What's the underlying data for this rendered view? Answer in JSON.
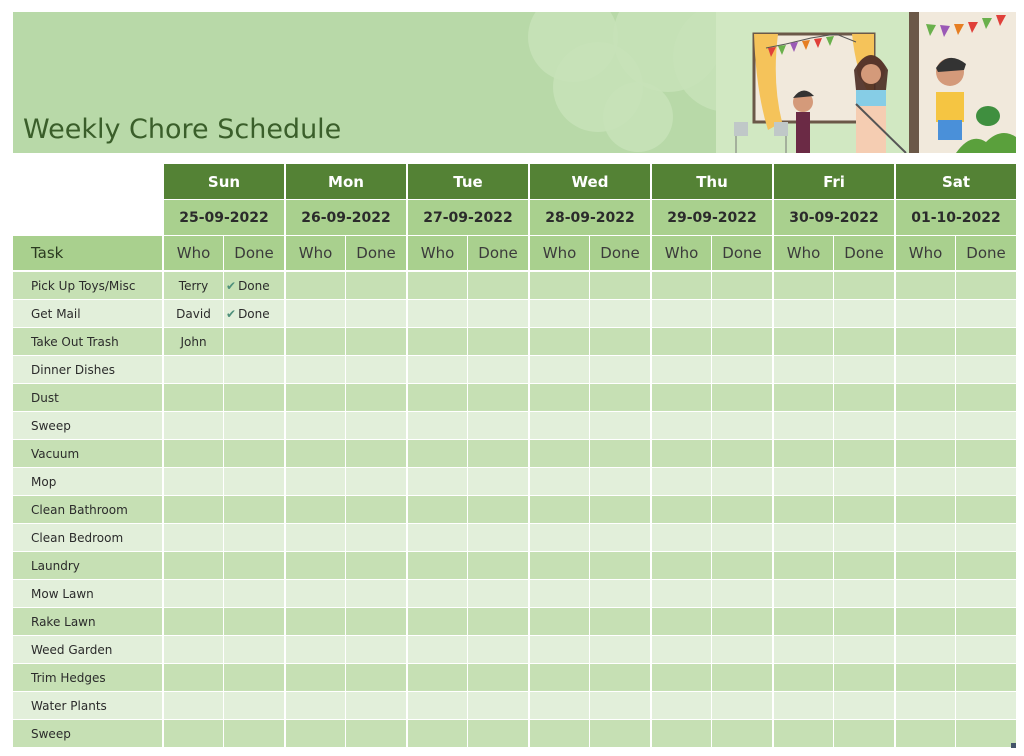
{
  "title": "Weekly Chore Schedule",
  "colors": {
    "day_header": "#548235",
    "date_header": "#a9d08e",
    "row_odd": "#c6e0b4",
    "row_even": "#e2efda",
    "banner": "#b8d9a8",
    "title_text": "#3a5e2a"
  },
  "columns": {
    "task": "Task",
    "who": "Who",
    "done": "Done"
  },
  "days": [
    {
      "name": "Sun",
      "date": "25-09-2022"
    },
    {
      "name": "Mon",
      "date": "26-09-2022"
    },
    {
      "name": "Tue",
      "date": "27-09-2022"
    },
    {
      "name": "Wed",
      "date": "28-09-2022"
    },
    {
      "name": "Thu",
      "date": "29-09-2022"
    },
    {
      "name": "Fri",
      "date": "30-09-2022"
    },
    {
      "name": "Sat",
      "date": "01-10-2022"
    }
  ],
  "done_icon": "check-icon",
  "tasks": [
    {
      "task": "Pick Up Toys/Misc",
      "entries": [
        {
          "who": "Terry",
          "done": "Done"
        },
        {},
        {},
        {},
        {},
        {},
        {}
      ]
    },
    {
      "task": "Get Mail",
      "entries": [
        {
          "who": "David",
          "done": "Done"
        },
        {},
        {},
        {},
        {},
        {},
        {}
      ]
    },
    {
      "task": "Take Out Trash",
      "entries": [
        {
          "who": "John",
          "done": ""
        },
        {},
        {},
        {},
        {},
        {},
        {}
      ]
    },
    {
      "task": "Dinner Dishes",
      "entries": [
        {},
        {},
        {},
        {},
        {},
        {},
        {}
      ]
    },
    {
      "task": "Dust",
      "entries": [
        {},
        {},
        {},
        {},
        {},
        {},
        {}
      ]
    },
    {
      "task": "Sweep",
      "entries": [
        {},
        {},
        {},
        {},
        {},
        {},
        {}
      ]
    },
    {
      "task": "Vacuum",
      "entries": [
        {},
        {},
        {},
        {},
        {},
        {},
        {}
      ]
    },
    {
      "task": "Mop",
      "entries": [
        {},
        {},
        {},
        {},
        {},
        {},
        {}
      ]
    },
    {
      "task": "Clean Bathroom",
      "entries": [
        {},
        {},
        {},
        {},
        {},
        {},
        {}
      ]
    },
    {
      "task": "Clean Bedroom",
      "entries": [
        {},
        {},
        {},
        {},
        {},
        {},
        {}
      ]
    },
    {
      "task": "Laundry",
      "entries": [
        {},
        {},
        {},
        {},
        {},
        {},
        {}
      ]
    },
    {
      "task": "Mow Lawn",
      "entries": [
        {},
        {},
        {},
        {},
        {},
        {},
        {}
      ]
    },
    {
      "task": "Rake Lawn",
      "entries": [
        {},
        {},
        {},
        {},
        {},
        {},
        {}
      ]
    },
    {
      "task": "Weed Garden",
      "entries": [
        {},
        {},
        {},
        {},
        {},
        {},
        {}
      ]
    },
    {
      "task": "Trim Hedges",
      "entries": [
        {},
        {},
        {},
        {},
        {},
        {},
        {}
      ]
    },
    {
      "task": "Water Plants",
      "entries": [
        {},
        {},
        {},
        {},
        {},
        {},
        {}
      ]
    },
    {
      "task": "Sweep",
      "entries": [
        {},
        {},
        {},
        {},
        {},
        {},
        {}
      ]
    }
  ]
}
